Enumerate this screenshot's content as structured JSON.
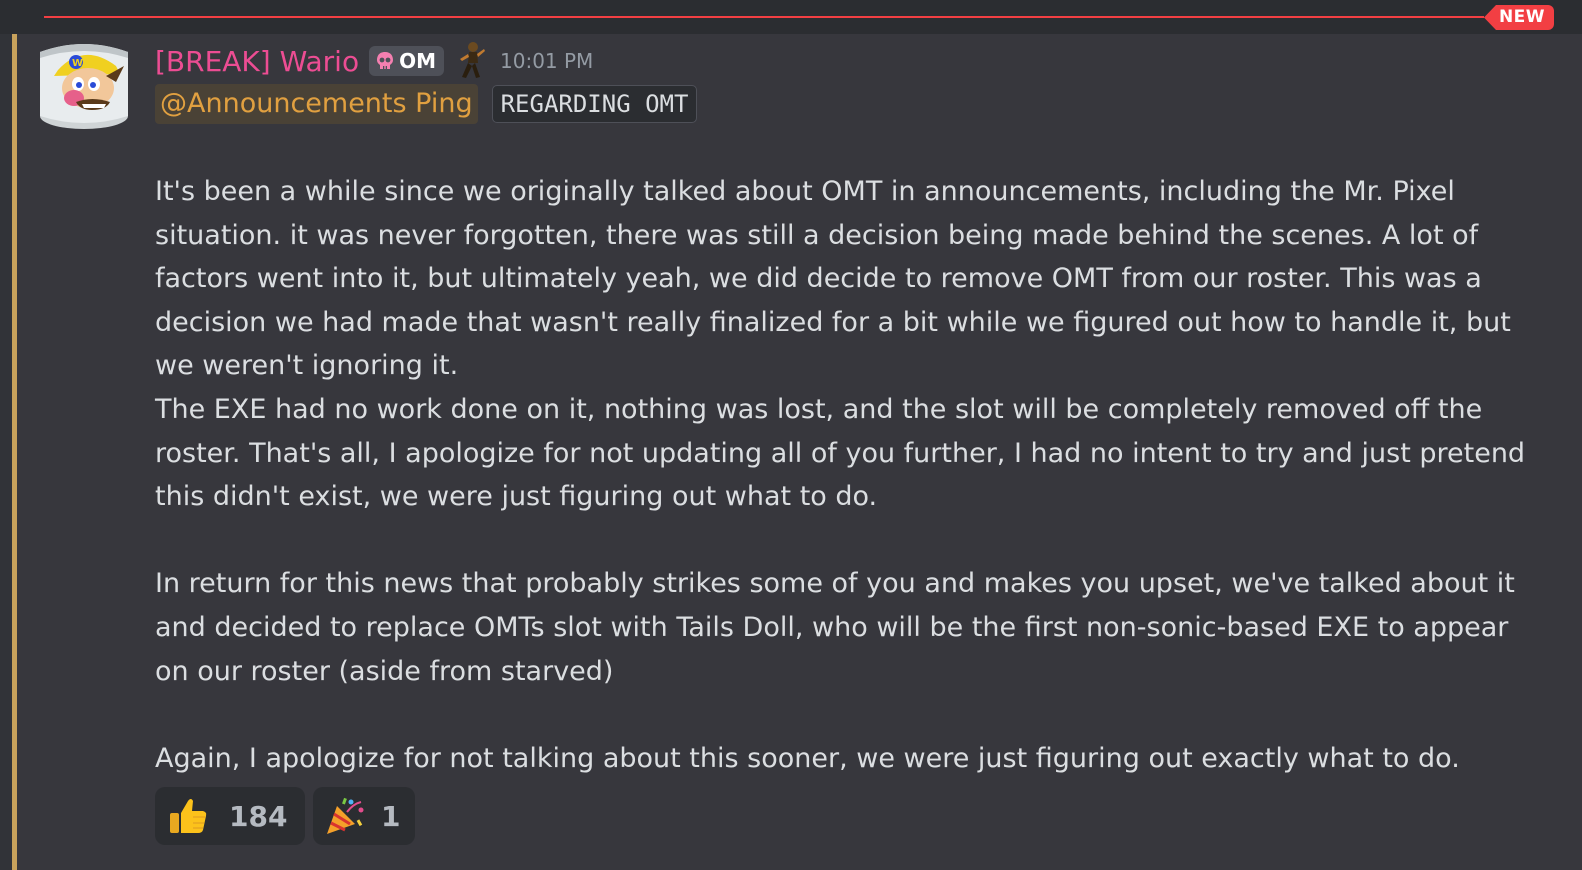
{
  "divider": {
    "new_label": "NEW"
  },
  "message": {
    "author": "[BREAK] Wario",
    "role_tag": "OM",
    "timestamp": "10:01 PM",
    "mention": "@Announcements Ping",
    "code_label": "REGARDING OMT",
    "paragraphs": [
      [
        "It's been a while since we originally talked about OMT in announcements, including the Mr. Pixel",
        "situation. it was never forgotten, there was still a decision being made behind the scenes. A lot of",
        "factors went into it, but ultimately yeah, we did decide to remove OMT from our roster. This was a",
        "decision we had made that wasn't really finalized for a bit while we figured out how to handle it, but",
        "we weren't ignoring it.",
        "The EXE had no work done on it, nothing was lost, and the slot will be completely removed off the",
        "roster. That's all, I apologize for not updating all of you further, I had no intent to try and just pretend",
        "this didn't exist, we were just figuring out what to do."
      ],
      [
        "In return for this news that probably strikes some of you and makes you upset, we've talked about it",
        "and decided to replace OMTs slot with Tails Doll, who will be the first non-sonic-based EXE to appear",
        "on our roster (aside from starved)"
      ],
      [
        "Again, I apologize for not talking about this sooner, we were just figuring out exactly what to do."
      ]
    ]
  },
  "reactions": [
    {
      "icon": "thumbs-up-icon",
      "count": "184"
    },
    {
      "icon": "party-popper-icon",
      "count": "1"
    }
  ],
  "colors": {
    "username": "#ec4d93",
    "mention": "#e1a040",
    "new_badge": "#f23f43",
    "accent_bar": "#c8a25c"
  }
}
